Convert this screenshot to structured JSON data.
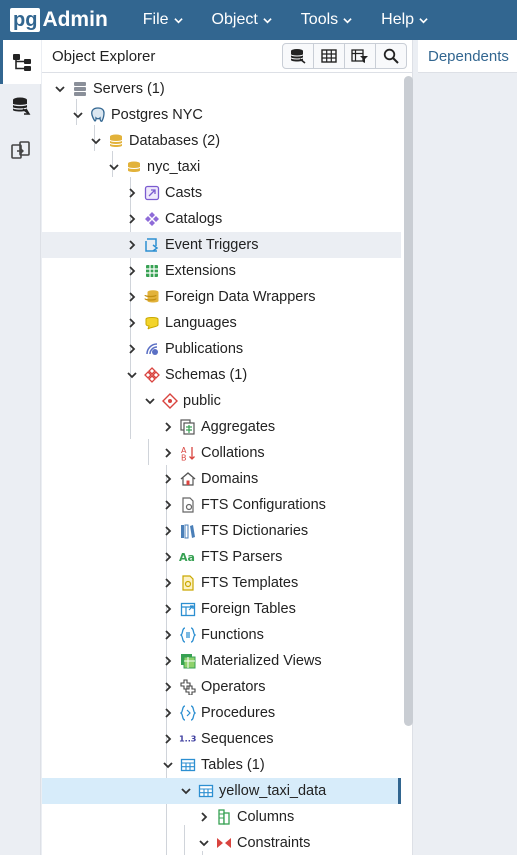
{
  "app": {
    "logo_pg": "pg",
    "logo_admin": "Admin",
    "brand_color": "#326690"
  },
  "menu": [
    {
      "label": "File"
    },
    {
      "label": "Object"
    },
    {
      "label": "Tools"
    },
    {
      "label": "Help"
    }
  ],
  "rail": [
    {
      "icon": "object-explorer-icon",
      "active": true
    },
    {
      "icon": "query-tool-icon",
      "active": false
    },
    {
      "icon": "schema-diff-icon",
      "active": false
    }
  ],
  "panel": {
    "title": "Object Explorer",
    "toolbar": [
      {
        "icon": "database-query-icon"
      },
      {
        "icon": "table-view-icon"
      },
      {
        "icon": "filtered-rows-icon"
      },
      {
        "icon": "search-icon"
      }
    ]
  },
  "tree": [
    {
      "label": "Servers",
      "count": "(1)",
      "expanded": true,
      "icon": "servers-icon"
    },
    {
      "label": "Postgres NYC",
      "count": "",
      "expanded": true,
      "icon": "postgres-elephant-icon"
    },
    {
      "label": "Databases",
      "count": "(2)",
      "expanded": true,
      "icon": "databases-icon"
    },
    {
      "label": "nyc_taxi",
      "count": "",
      "expanded": true,
      "icon": "database-icon"
    },
    {
      "label": "Casts",
      "count": "",
      "expanded": false,
      "icon": "casts-icon"
    },
    {
      "label": "Catalogs",
      "count": "",
      "expanded": false,
      "icon": "catalogs-icon"
    },
    {
      "label": "Event Triggers",
      "count": "",
      "expanded": false,
      "icon": "event-triggers-icon"
    },
    {
      "label": "Extensions",
      "count": "",
      "expanded": false,
      "icon": "extensions-icon"
    },
    {
      "label": "Foreign Data Wrappers",
      "count": "",
      "expanded": false,
      "icon": "foreign-data-wrappers-icon"
    },
    {
      "label": "Languages",
      "count": "",
      "expanded": false,
      "icon": "languages-icon"
    },
    {
      "label": "Publications",
      "count": "",
      "expanded": false,
      "icon": "publications-icon"
    },
    {
      "label": "Schemas",
      "count": "(1)",
      "expanded": true,
      "icon": "schemas-icon"
    },
    {
      "label": "public",
      "count": "",
      "expanded": true,
      "icon": "schema-icon"
    },
    {
      "label": "Aggregates",
      "count": "",
      "expanded": false,
      "icon": "aggregates-icon"
    },
    {
      "label": "Collations",
      "count": "",
      "expanded": false,
      "icon": "collations-icon"
    },
    {
      "label": "Domains",
      "count": "",
      "expanded": false,
      "icon": "domains-icon"
    },
    {
      "label": "FTS Configurations",
      "count": "",
      "expanded": false,
      "icon": "fts-configurations-icon"
    },
    {
      "label": "FTS Dictionaries",
      "count": "",
      "expanded": false,
      "icon": "fts-dictionaries-icon"
    },
    {
      "label": "FTS Parsers",
      "count": "",
      "expanded": false,
      "icon": "fts-parsers-icon"
    },
    {
      "label": "FTS Templates",
      "count": "",
      "expanded": false,
      "icon": "fts-templates-icon"
    },
    {
      "label": "Foreign Tables",
      "count": "",
      "expanded": false,
      "icon": "foreign-tables-icon"
    },
    {
      "label": "Functions",
      "count": "",
      "expanded": false,
      "icon": "functions-icon"
    },
    {
      "label": "Materialized Views",
      "count": "",
      "expanded": false,
      "icon": "materialized-views-icon"
    },
    {
      "label": "Operators",
      "count": "",
      "expanded": false,
      "icon": "operators-icon"
    },
    {
      "label": "Procedures",
      "count": "",
      "expanded": false,
      "icon": "procedures-icon"
    },
    {
      "label": "Sequences",
      "count": "",
      "expanded": false,
      "icon": "sequences-icon"
    },
    {
      "label": "Tables",
      "count": "(1)",
      "expanded": true,
      "icon": "tables-icon"
    },
    {
      "label": "yellow_taxi_data",
      "count": "",
      "expanded": true,
      "icon": "table-icon"
    },
    {
      "label": "Columns",
      "count": "",
      "expanded": false,
      "icon": "columns-icon"
    },
    {
      "label": "Constraints",
      "count": "",
      "expanded": false,
      "icon": "constraints-icon"
    }
  ],
  "right_panel": {
    "tab_label": "Dependents"
  }
}
